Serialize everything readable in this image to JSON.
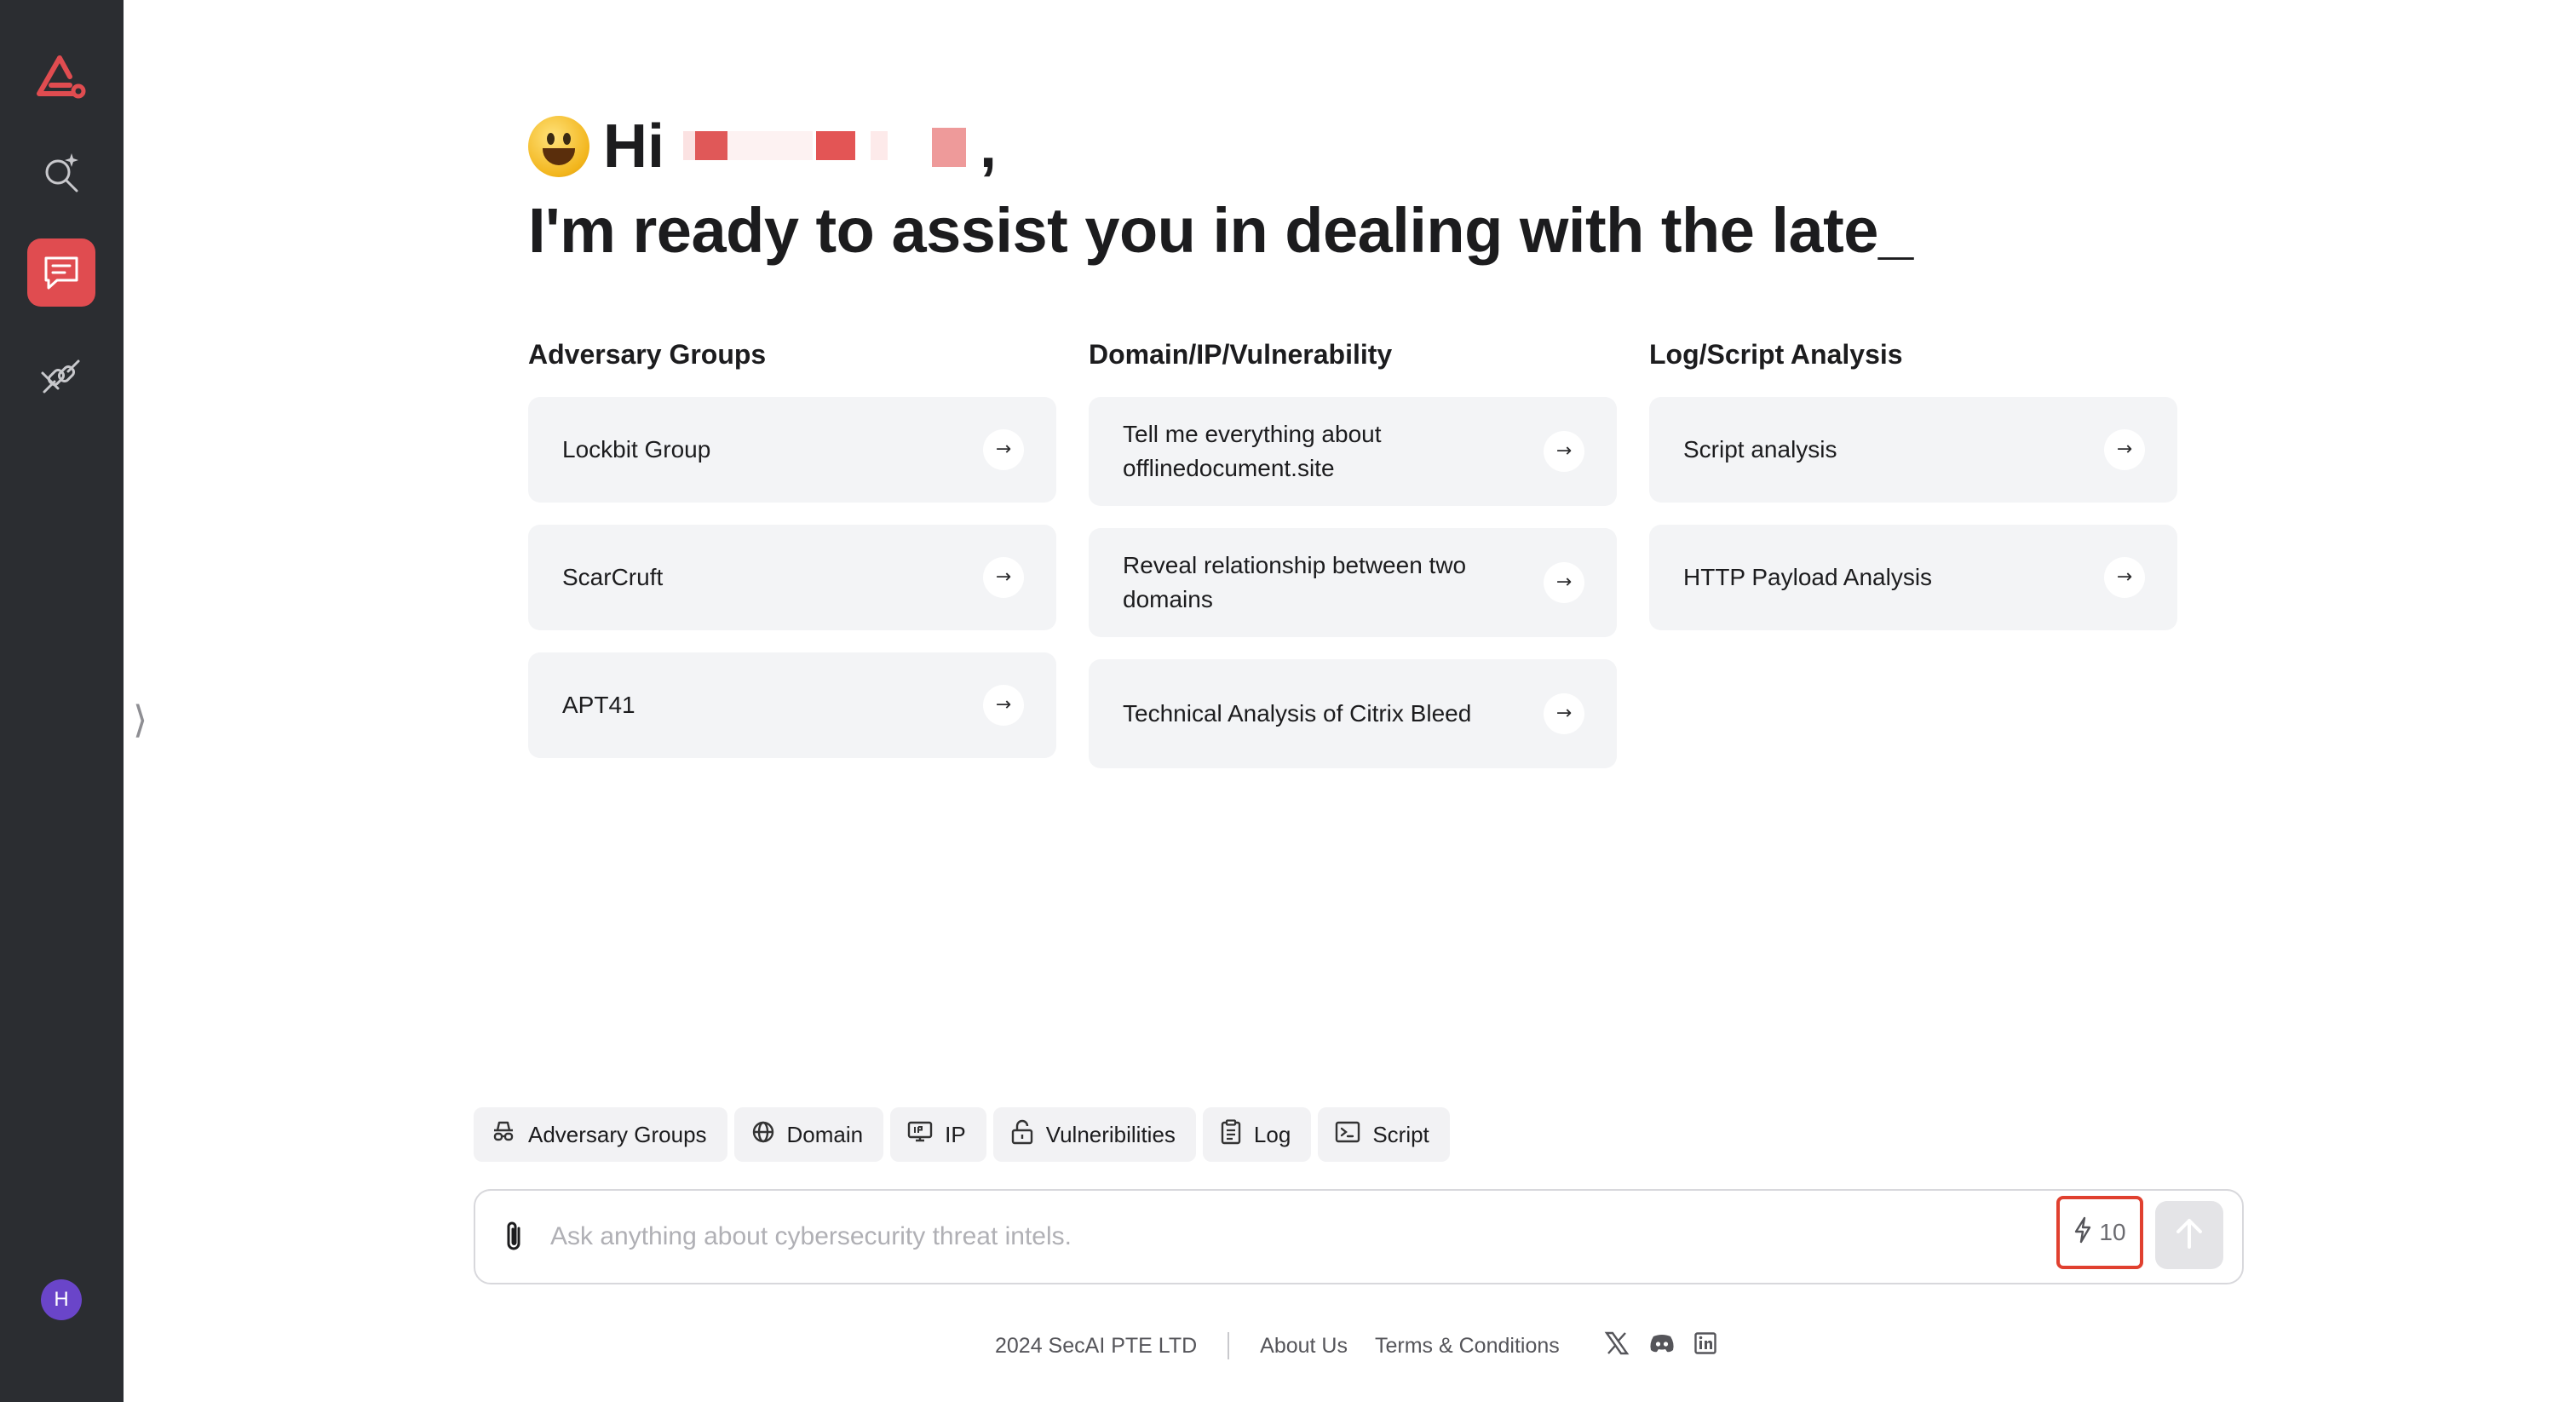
{
  "sidebar": {
    "items": [
      {
        "icon": "logo-icon"
      },
      {
        "icon": "search-sparkle-icon"
      },
      {
        "icon": "chat-icon",
        "active": true
      },
      {
        "icon": "integration-icon"
      }
    ],
    "avatar_initial": "H",
    "expand_glyph": "⟩"
  },
  "greeting": {
    "hi": "Hi",
    "comma": ",",
    "headline": "I'm ready to assist you in dealing with the late_"
  },
  "columns": [
    {
      "title": "Adversary Groups",
      "cards": [
        "Lockbit Group",
        "ScarCruft",
        "APT41"
      ]
    },
    {
      "title": "Domain/IP/Vulnerability",
      "cards": [
        "Tell me everything about offlinedocument.site",
        "Reveal relationship between two domains",
        "Technical Analysis of Citrix Bleed"
      ]
    },
    {
      "title": "Log/Script Analysis",
      "cards": [
        "Script analysis",
        "HTTP Payload Analysis"
      ]
    }
  ],
  "chips": [
    {
      "label": "Adversary Groups",
      "icon": "spy-icon"
    },
    {
      "label": "Domain",
      "icon": "globe-icon"
    },
    {
      "label": "IP",
      "icon": "ip-monitor-icon"
    },
    {
      "label": "Vulneribilities",
      "icon": "unlock-icon"
    },
    {
      "label": "Log",
      "icon": "clipboard-icon"
    },
    {
      "label": "Script",
      "icon": "terminal-icon"
    }
  ],
  "input": {
    "placeholder": "Ask anything about cybersecurity threat intels.",
    "credits": "10"
  },
  "footer": {
    "copyright": "2024 SecAI PTE LTD",
    "about": "About Us",
    "terms": "Terms & Conditions",
    "social": [
      "x-icon",
      "discord-icon",
      "linkedin-icon"
    ]
  },
  "colors": {
    "sidebar_bg": "#2b2d31",
    "accent": "#e04c50",
    "card_bg": "#f3f4f6",
    "credits_highlight": "#e0402f",
    "avatar_bg": "#6a45c9"
  }
}
